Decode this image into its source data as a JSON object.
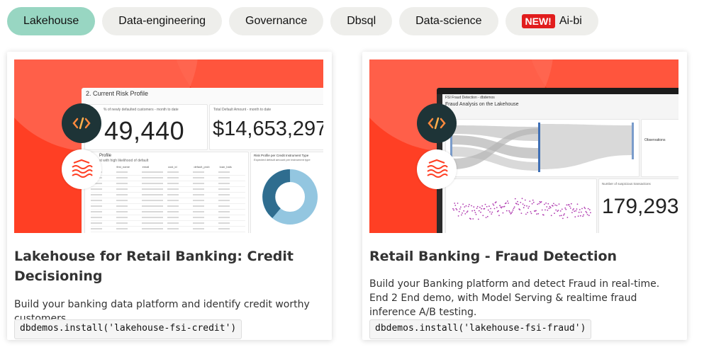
{
  "tabs": [
    {
      "label": "Lakehouse",
      "active": true
    },
    {
      "label": "Data-engineering",
      "active": false
    },
    {
      "label": "Governance",
      "active": false
    },
    {
      "label": "Dbsql",
      "active": false
    },
    {
      "label": "Data-science",
      "active": false
    },
    {
      "label": "Ai-bi",
      "active": false,
      "badge": "NEW!"
    }
  ],
  "cards": [
    {
      "title": "Lakehouse for Retail Banking: Credit Decisioning",
      "description": "Build your banking data platform and identify credit worthy customers.",
      "code": "dbdemos.install('lakehouse-fsi-credit')",
      "preview": {
        "heading": "2. Current Risk Profile",
        "kpi1_label": "% of newly defaulted customers - month to date",
        "kpi1_value": "49,440",
        "kpi2_label": "Total Default Amount - month to date",
        "kpi2_value": "$14,653,297",
        "table_title": "Profile",
        "table_sub": "st with high likelihood of default",
        "table_cols": [
          "r_name",
          "first_name",
          "email",
          "cust_id",
          "default_prob",
          "loan_bals"
        ],
        "donut_title": "Risk Profile per Credit Instrument Type",
        "donut_sub": "Expected default amount per instrument type"
      }
    },
    {
      "title": "Retail Banking - Fraud Detection",
      "description": "Build your Banking platform and detect Fraud in real-time. End 2 End demo, with Model Serving & realtime fraud inference A/B testing.",
      "code": "dbdemos.install('lakehouse-fsi-fraud')",
      "preview": {
        "app_title": "FSI Fraud Detection - dbdemos",
        "heading": "Fraud Analysis on the Lakehouse",
        "observations_label": "Observations",
        "kpi_value": "179,293",
        "kpi_label": "Number of suspicious transactions"
      }
    }
  ],
  "colors": {
    "tab_bg": "#eeeeeb",
    "tab_active_bg": "#98d6c2",
    "badge_bg": "#e11d1d",
    "banner_red": "#ff3f24",
    "icon_dark": "#1e3437",
    "icon_lake": "#ff3f24"
  },
  "icons": [
    "code-brackets-icon",
    "lakehouse-waves-icon"
  ]
}
